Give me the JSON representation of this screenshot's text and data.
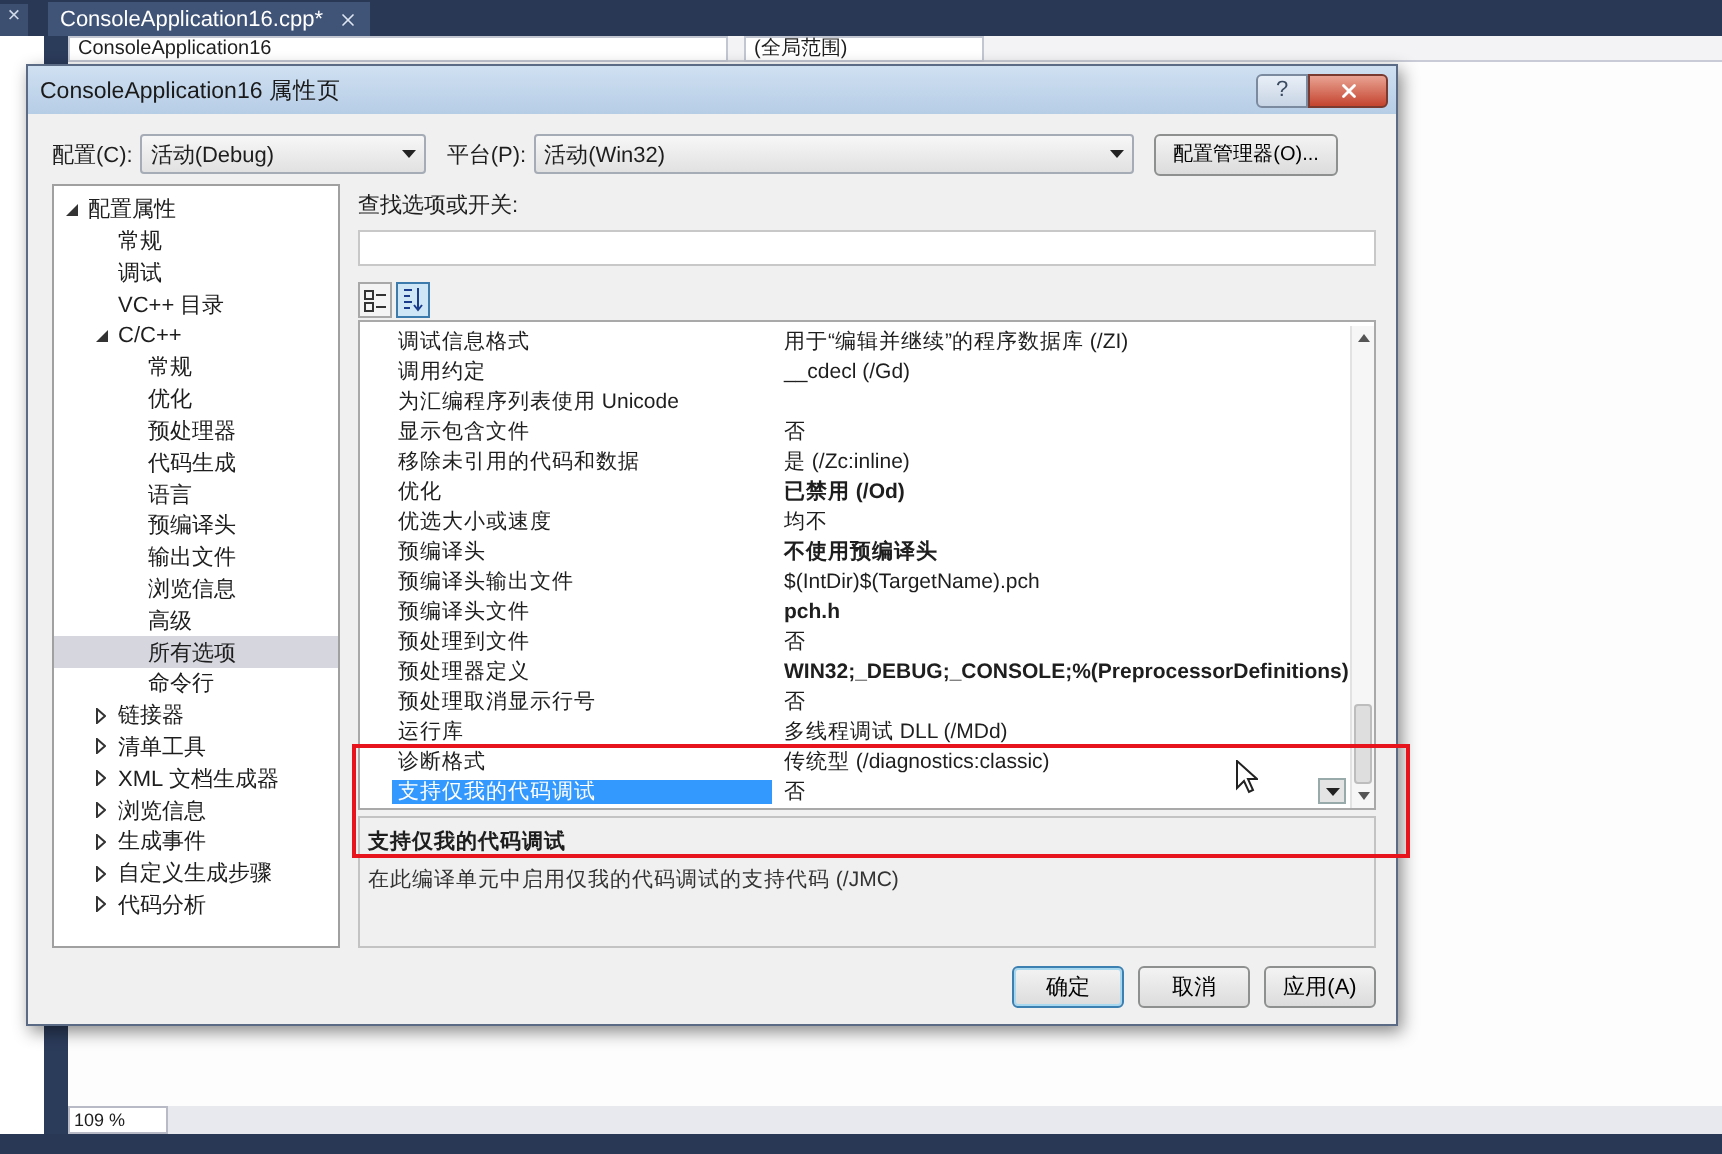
{
  "ide": {
    "side_tab_close": "×",
    "document_tab": {
      "label": "ConsoleApplication16.cpp*",
      "selected": true
    },
    "class_dropdown": "ConsoleApplication16",
    "scope_dropdown": "(全局范围)",
    "zoom": "109 %"
  },
  "dialog": {
    "title": "ConsoleApplication16 属性页",
    "help": "?",
    "config_label": "配置(C):",
    "config_value": "活动(Debug)",
    "platform_label": "平台(P):",
    "platform_value": "活动(Win32)",
    "config_manager": "配置管理器(O)...",
    "tree": [
      {
        "label": "配置属性",
        "kind": "folder",
        "expanded": true,
        "selected": false,
        "children": [
          {
            "label": "常规",
            "kind": "leaf",
            "selected": false
          },
          {
            "label": "调试",
            "kind": "leaf",
            "selected": false
          },
          {
            "label": "VC++ 目录",
            "kind": "leaf",
            "selected": false
          },
          {
            "label": "C/C++",
            "kind": "folder",
            "expanded": true,
            "selected": false,
            "children": [
              {
                "label": "常规",
                "kind": "leaf",
                "selected": false
              },
              {
                "label": "优化",
                "kind": "leaf",
                "selected": false
              },
              {
                "label": "预处理器",
                "kind": "leaf",
                "selected": false
              },
              {
                "label": "代码生成",
                "kind": "leaf",
                "selected": false
              },
              {
                "label": "语言",
                "kind": "leaf",
                "selected": false
              },
              {
                "label": "预编译头",
                "kind": "leaf",
                "selected": false
              },
              {
                "label": "输出文件",
                "kind": "leaf",
                "selected": false
              },
              {
                "label": "浏览信息",
                "kind": "leaf",
                "selected": false
              },
              {
                "label": "高级",
                "kind": "leaf",
                "selected": false
              },
              {
                "label": "所有选项",
                "kind": "leaf",
                "selected": true
              },
              {
                "label": "命令行",
                "kind": "leaf",
                "selected": false
              }
            ]
          },
          {
            "label": "链接器",
            "kind": "folder",
            "expanded": false,
            "selected": false
          },
          {
            "label": "清单工具",
            "kind": "folder",
            "expanded": false,
            "selected": false
          },
          {
            "label": "XML 文档生成器",
            "kind": "folder",
            "expanded": false,
            "selected": false
          },
          {
            "label": "浏览信息",
            "kind": "folder",
            "expanded": false,
            "selected": false
          },
          {
            "label": "生成事件",
            "kind": "folder",
            "expanded": false,
            "selected": false
          },
          {
            "label": "自定义生成步骤",
            "kind": "folder",
            "expanded": false,
            "selected": false
          },
          {
            "label": "代码分析",
            "kind": "folder",
            "expanded": false,
            "selected": false
          }
        ]
      }
    ],
    "search_label": "查找选项或开关:",
    "view_buttons": [
      {
        "kind": "categorized",
        "selected": false
      },
      {
        "kind": "alphabetical",
        "selected": true
      }
    ],
    "properties": [
      {
        "name": "调试信息格式",
        "value": "用于“编辑并继续”的程序数据库 (/ZI)",
        "modified": false,
        "selected": false
      },
      {
        "name": "调用约定",
        "value": "__cdecl (/Gd)",
        "modified": false,
        "selected": false
      },
      {
        "name": "为汇编程序列表使用 Unicode",
        "selected": false
      },
      {
        "name": "显示包含文件",
        "value": "否",
        "modified": false,
        "selected": false
      },
      {
        "name": "移除未引用的代码和数据",
        "value": "是 (/Zc:inline)",
        "modified": false,
        "selected": false
      },
      {
        "name": "优化",
        "value": "已禁用 (/Od)",
        "modified": true,
        "selected": false
      },
      {
        "name": "优选大小或速度",
        "value": "均不",
        "modified": false,
        "selected": false
      },
      {
        "name": "预编译头",
        "value": "不使用预编译头",
        "modified": true,
        "selected": false
      },
      {
        "name": "预编译头输出文件",
        "value": "$(IntDir)$(TargetName).pch",
        "modified": false,
        "selected": false
      },
      {
        "name": "预编译头文件",
        "value": "pch.h",
        "modified": true,
        "selected": false
      },
      {
        "name": "预处理到文件",
        "value": "否",
        "modified": false,
        "selected": false
      },
      {
        "name": "预处理器定义",
        "value": "WIN32;_DEBUG;_CONSOLE;%(PreprocessorDefinitions)",
        "modified": true,
        "selected": false
      },
      {
        "name": "预处理取消显示行号",
        "value": "否",
        "modified": false,
        "selected": false
      },
      {
        "name": "运行库",
        "value": "多线程调试 DLL (/MDd)",
        "modified": false,
        "selected": false
      },
      {
        "name": "诊断格式",
        "value": "传统型 (/diagnostics:classic)",
        "modified": false,
        "selected": false
      },
      {
        "name": "支持仅我的代码调试",
        "value": "否",
        "modified": false,
        "selected": true
      }
    ],
    "description": {
      "title": "支持仅我的代码调试",
      "text": "在此编译单元中启用仅我的代码调试的支持代码 (/JMC)"
    },
    "buttons": [
      {
        "label": "确定",
        "default": true
      },
      {
        "label": "取消",
        "default": false
      },
      {
        "label": "应用(A)",
        "default": false
      }
    ]
  }
}
